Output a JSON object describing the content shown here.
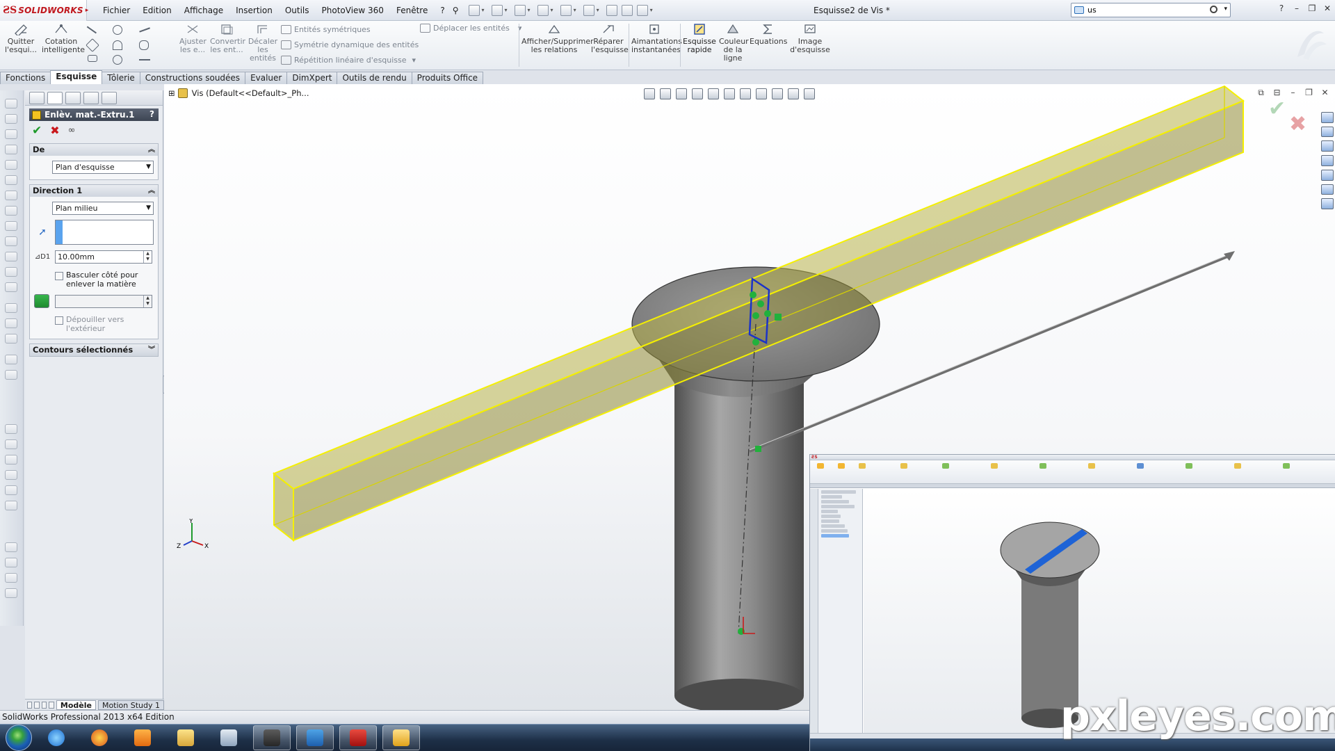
{
  "app": {
    "logo_text": "SOLIDWORKS",
    "document_title": "Esquisse2 de Vis *",
    "accent_color": "#c0171d"
  },
  "menu": {
    "items": [
      "Fichier",
      "Edition",
      "Affichage",
      "Insertion",
      "Outils",
      "PhotoView 360",
      "Fenêtre",
      "?"
    ]
  },
  "search": {
    "value": "us"
  },
  "ribbon": {
    "exit_sketch": "Quitter l'esqui...",
    "smart_dimension": "Cotation intelligente",
    "trim": "Ajuster les e...",
    "convert": "Convertir les ent...",
    "offset": "Décaler les entités",
    "mirror": "Entités symétriques",
    "dynamic_mirror": "Symétrie dynamique des entités",
    "linear_pattern": "Répétition linéaire d'esquisse",
    "move_entities": "Déplacer les entités",
    "show_relations": "Afficher/Supprimer les relations",
    "repair_sketch": "Réparer l'esquisse",
    "quick_snaps": "Aimantations instantanées",
    "rapid_sketch": "Esquisse rapide",
    "line_color": "Couleur de la ligne",
    "equations": "Equations",
    "sketch_picture": "Image d'esquisse"
  },
  "tabs": [
    "Fonctions",
    "Esquisse",
    "Tôlerie",
    "Constructions soudées",
    "Evaluer",
    "DimXpert",
    "Outils de rendu",
    "Produits Office"
  ],
  "active_tab": "Esquisse",
  "property_manager": {
    "title": "Enlèv. mat.-Extru.1",
    "help": "?",
    "from": {
      "header": "De",
      "value": "Plan d'esquisse"
    },
    "direction1": {
      "header": "Direction 1",
      "end_condition": "Plan milieu",
      "depth": "10.00mm",
      "flip_label": "Basculer côté pour enlever la matière",
      "draft_label": "Dépouiller vers l'extérieur"
    },
    "contours": {
      "header": "Contours sélectionnés"
    }
  },
  "viewport": {
    "tree_item": "Vis  (Default<<Default>_Ph...",
    "axis_x": "X",
    "axis_y": "Y",
    "axis_z": "Z",
    "colors": {
      "part": "#8f8f8f",
      "extrude_preview": "#b8b24a",
      "highlight": "#f5f000",
      "sketch": "#1b33c8",
      "relations": "#21b13c"
    }
  },
  "bottom_tabs": [
    "Modèle",
    "Motion Study 1"
  ],
  "status": {
    "text": "SolidWorks Professional 2013 x64 Edition"
  },
  "watermark": "pxleyes.com"
}
